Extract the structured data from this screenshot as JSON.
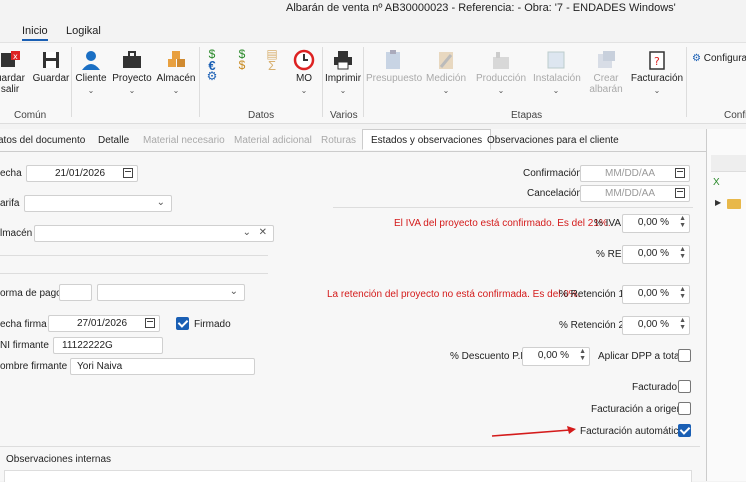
{
  "window": {
    "title": "Albarán de venta nº AB30000023 - Referencia:  - Obra: '7 - ENDADES Windows'"
  },
  "menu": {
    "inicio": "Inicio",
    "logikal": "Logikal"
  },
  "ribbon": {
    "guardar_salir": "uardar\nsalir",
    "guardar": "Guardar",
    "cliente": "Cliente",
    "proyecto": "Proyecto",
    "almacen": "Almacén",
    "mo": "MO",
    "imprimir": "Imprimir",
    "presupuesto": "Presupuesto",
    "medicion": "Medición",
    "produccion": "Producción",
    "instalacion": "Instalación",
    "crear_albaran": "Crear\nalbarán",
    "facturacion": "Facturación",
    "configura": "Configura",
    "groups": {
      "comun": "Común",
      "datos": "Datos",
      "varios": "Varios",
      "etapas": "Etapas",
      "confi": "Confi"
    }
  },
  "tabs": [
    "atos del documento",
    "Detalle",
    "Material necesario",
    "Material adicional",
    "Roturas",
    "Estados y observaciones",
    "Observaciones para el cliente"
  ],
  "form": {
    "fecha_label": "echa",
    "fecha_value": "21/01/2026",
    "tarifa_label": "arifa",
    "almacen_label": "lmacén",
    "forma_pago_label": "orma de pago",
    "fecha_firma_label": "echa firma",
    "fecha_firma_value": "27/01/2026",
    "firmado_label": "Firmado",
    "dni_label": "NI firmante",
    "dni_value": "11122222G",
    "nombre_label": "ombre firmante",
    "nombre_value": "Yori Naiva",
    "confirmacion_label": "Confirmación",
    "cancelacion_label": "Cancelación",
    "date_placeholder": "MM/DD/AA",
    "iva_note": "El IVA del proyecto está confirmado. Es del 21%.",
    "iva_label": "% IVA",
    "iva_value": "0,00 %",
    "re_label": "% RE",
    "re_value": "0,00 %",
    "ret_note": "La retención del proyecto no está confirmada. Es del 0%.",
    "ret1_label": "% Retención 1",
    "ret1_value": "0,00 %",
    "ret2_label": "% Retención 2",
    "ret2_value": "0,00 %",
    "dpp_label": "% Descuento P.P.",
    "dpp_value": "0,00 %",
    "aplicar_dpp_label": "Aplicar DPP a total",
    "facturado_label": "Facturado",
    "fact_origen_label": "Facturación a origen",
    "fact_auto_label": "Facturación automática",
    "obs_internas_label": "Observaciones internas"
  },
  "colors": {
    "accent": "#1a5fb4",
    "red_note": "#d41b1b",
    "arrow": "#d41b1b"
  }
}
